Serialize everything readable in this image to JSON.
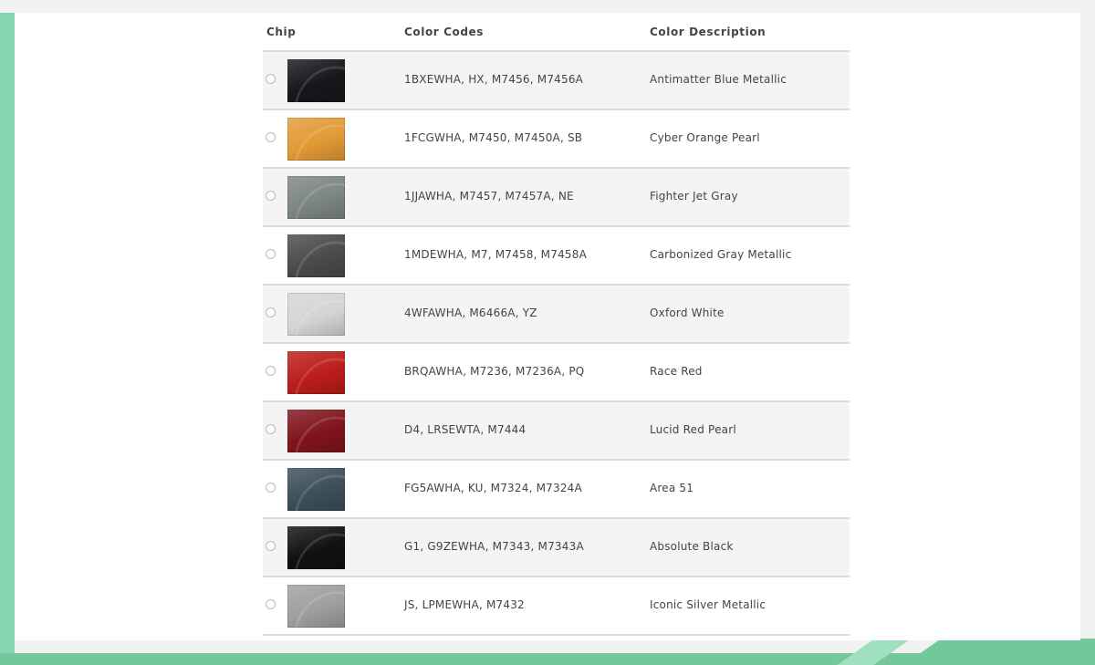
{
  "table": {
    "headers": {
      "chip": "Chip",
      "codes": "Color Codes",
      "description": "Color Description"
    },
    "rows": [
      {
        "codes": "1BXEWHA, HX, M7456, M7456A",
        "description": "Antimatter Blue Metallic",
        "swatch_color": "#15171b"
      },
      {
        "codes": "1FCGWHA, M7450, M7450A, SB",
        "description": "Cyber Orange Pearl",
        "swatch_color": "#e29a36"
      },
      {
        "codes": "1JJAWHA, M7457, M7457A, NE",
        "description": "Fighter Jet Gray",
        "swatch_color": "#7d8682"
      },
      {
        "codes": "1MDEWHA, M7, M7458, M7458A",
        "description": "Carbonized Gray Metallic",
        "swatch_color": "#4b4b4b"
      },
      {
        "codes": "4WFAWHA, M6466A, YZ",
        "description": "Oxford White",
        "swatch_color": "#d3d6d5"
      },
      {
        "codes": "BRQAWHA, M7236, M7236A, PQ",
        "description": "Race Red",
        "swatch_color": "#bb1d1a"
      },
      {
        "codes": "D4, LRSEWTA, M7444",
        "description": "Lucid Red Pearl",
        "swatch_color": "#80141c"
      },
      {
        "codes": "FG5AWHA, KU, M7324, M7324A",
        "description": "Area 51",
        "swatch_color": "#3c4f5a"
      },
      {
        "codes": "G1, G9ZEWHA, M7343, M7343A",
        "description": "Absolute Black",
        "swatch_color": "#111111"
      },
      {
        "codes": "JS, LPMEWHA, M7432",
        "description": "Iconic Silver Metallic",
        "swatch_color": "#9d9fa1"
      }
    ]
  }
}
